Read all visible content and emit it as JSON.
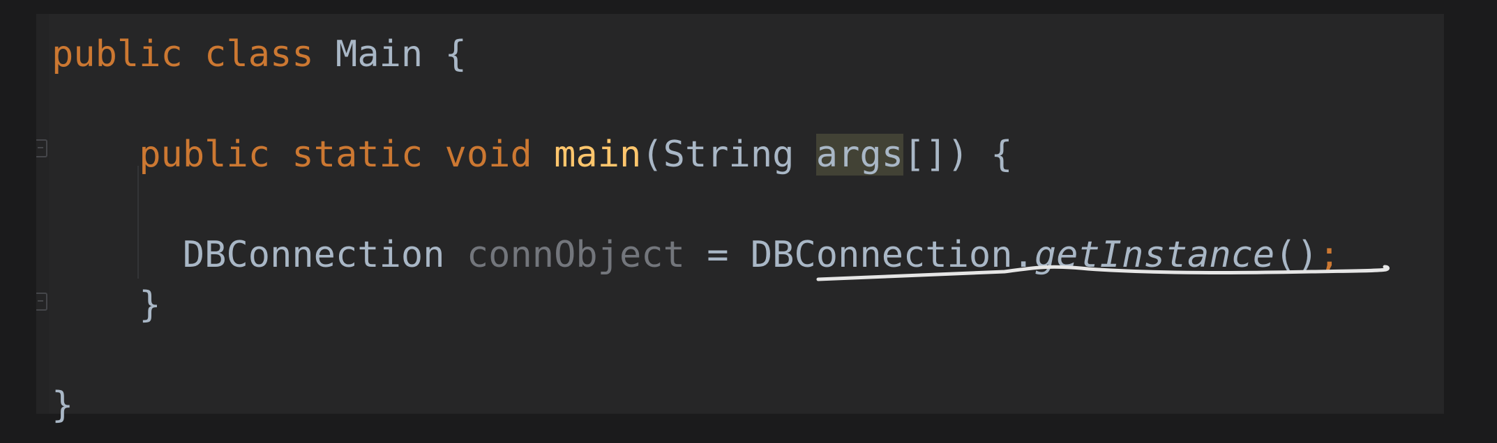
{
  "editor": {
    "line1": {
      "kw_public": "public",
      "kw_class": "class",
      "class_name": "Main",
      "brace_open": "{"
    },
    "line2": {
      "kw_public": "public",
      "kw_static": "static",
      "kw_void": "void",
      "method_name": "main",
      "paren_open": "(",
      "param_type": "String",
      "param_name": "args",
      "param_suffix": "[])",
      "brace_open": "{"
    },
    "line3": {
      "type_name": "DBConnection",
      "var_name": "connObject",
      "assign": "=",
      "call_class": "DBConnection",
      "dot": ".",
      "call_method": "getInstance",
      "call_parens": "()",
      "semicolon": ";"
    },
    "line4": {
      "brace_close": "}"
    },
    "line5": {
      "brace_close": "}"
    }
  },
  "colors": {
    "keyword": "#cc7832",
    "method_declaration": "#ffc66d",
    "identifier": "#a9b7c6",
    "unused_variable": "#73767c",
    "highlight_background": "#424235",
    "editor_background": "#262627",
    "outer_background": "#1b1b1c",
    "annotation_stroke": "#e6e6e6"
  },
  "icons": {
    "fold_markers": [
      "fold-open-icon",
      "fold-close-icon"
    ]
  }
}
